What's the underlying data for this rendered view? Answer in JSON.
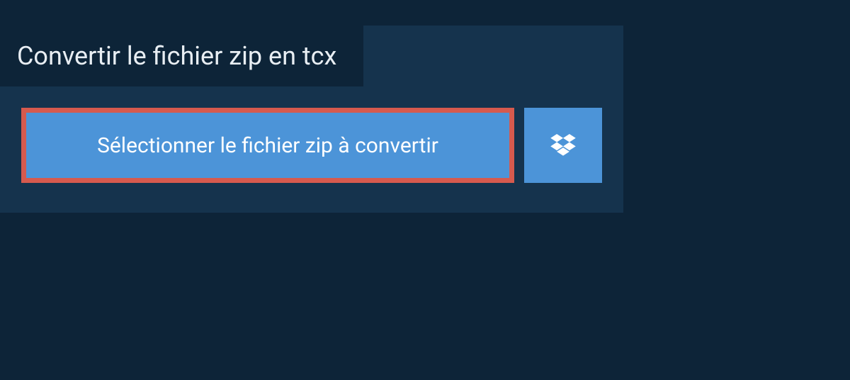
{
  "title": "Convertir le fichier zip en tcx",
  "buttons": {
    "select_file": "Sélectionner le fichier zip à convertir"
  }
}
